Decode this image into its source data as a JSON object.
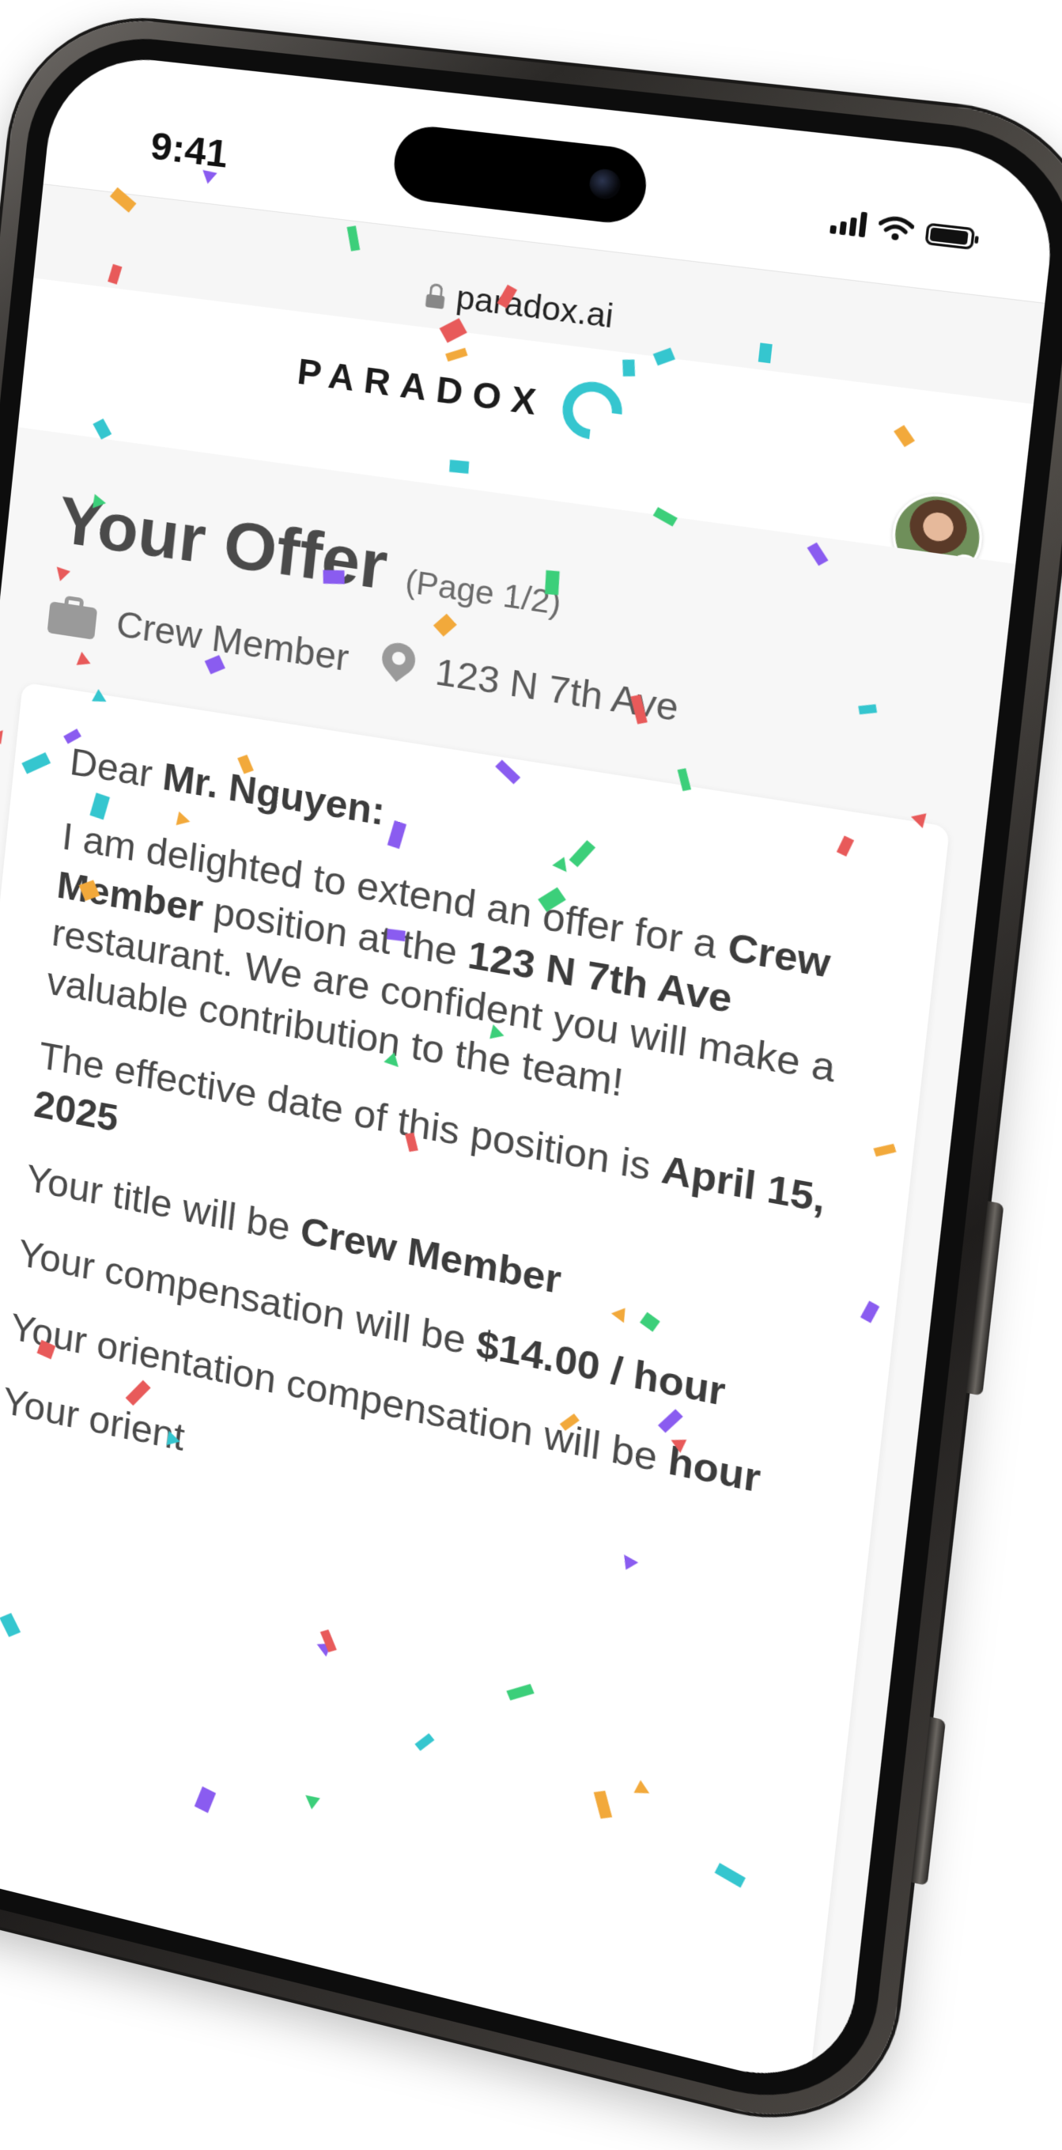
{
  "status_bar": {
    "time": "9:41"
  },
  "browser": {
    "url": "paradox.ai"
  },
  "header": {
    "brand": "PARADOX"
  },
  "offer": {
    "title": "Your Offer",
    "page": "(Page 1/2)",
    "position": "Crew Member",
    "location": "123 N 7th Ave"
  },
  "letter": {
    "greeting_prefix": "Dear ",
    "recipient": "Mr. Nguyen",
    "greeting_suffix": ":",
    "p1_prefix": "I am delighted to extend an offer for a ",
    "p1_role": "Crew Member",
    "p1_mid": " position at the ",
    "p1_location": "123 N 7th Ave",
    "p1_suffix": " restaurant.  We are confident you will make a valuable contribution to the team!",
    "p2_prefix": "The effective date of this position is ",
    "p2_date": "April 15, 2025",
    "p3_prefix": "Your title will be ",
    "p3_title": "Crew Member",
    "p4_prefix": "Your compensation will be ",
    "p4_pay": "$14.00 / hour",
    "p5_prefix": "Your orientation compensation will be ",
    "p5_pay": "hour",
    "p6_prefix": "Your orient"
  },
  "colors": {
    "accent": "#35c6cf",
    "confetti": [
      "#e85a5a",
      "#8a5cf0",
      "#35c6cf",
      "#3ccf7a",
      "#f2a93b"
    ]
  }
}
